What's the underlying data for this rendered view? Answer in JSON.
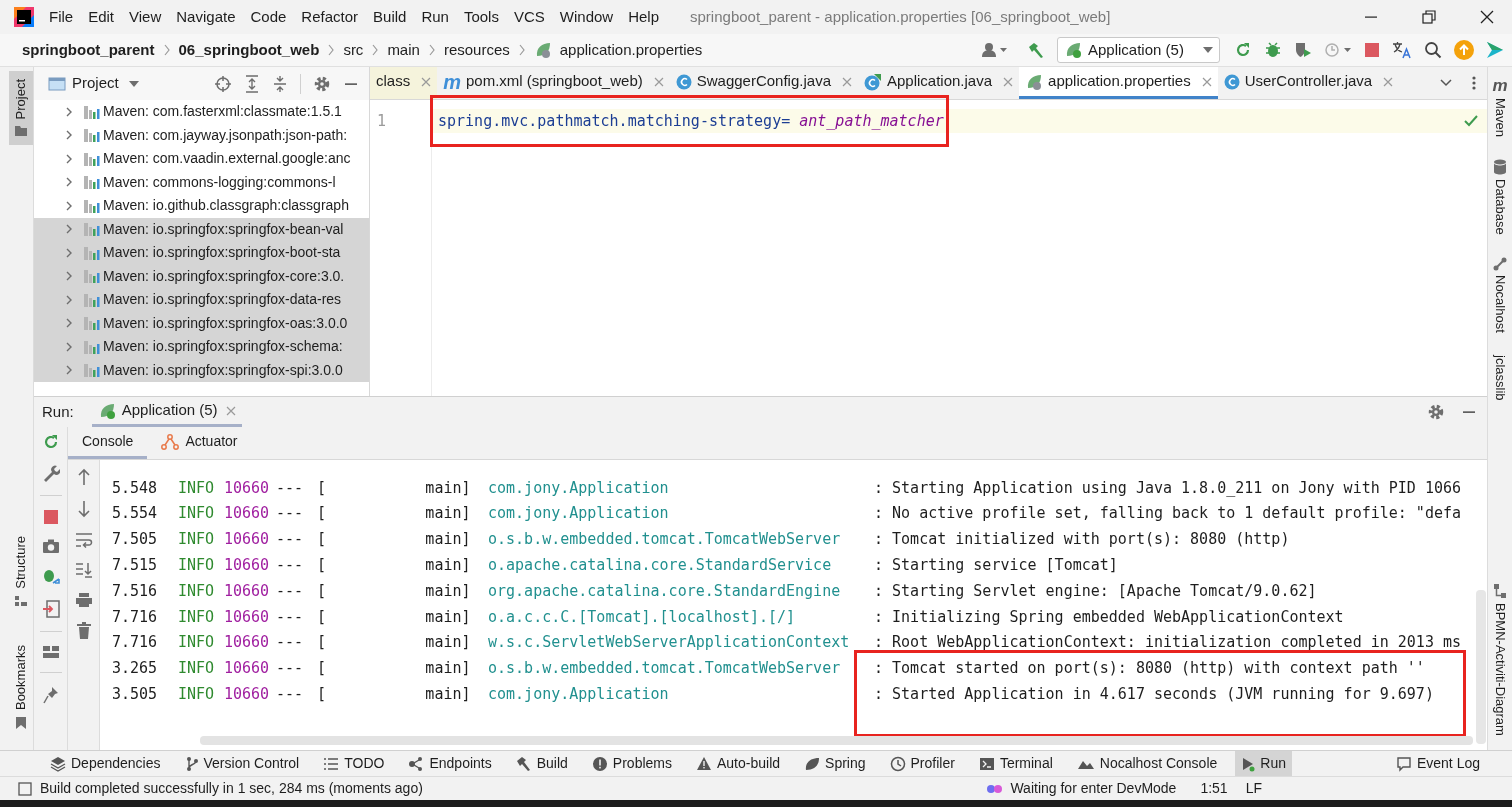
{
  "window": {
    "title": "springboot_parent - application.properties [06_springboot_web]"
  },
  "menu": [
    "File",
    "Edit",
    "View",
    "Navigate",
    "Code",
    "Refactor",
    "Build",
    "Run",
    "Tools",
    "VCS",
    "Window",
    "Help"
  ],
  "breadcrumb": [
    {
      "label": "springboot_parent",
      "bold": true
    },
    {
      "label": "06_springboot_web",
      "bold": true
    },
    {
      "label": "src",
      "bold": false
    },
    {
      "label": "main",
      "bold": false
    },
    {
      "label": "resources",
      "bold": false
    },
    {
      "label": "application.properties",
      "bold": false,
      "kind": "file"
    }
  ],
  "toolbar": {
    "run_config": "Application (5)"
  },
  "left_stripe": {
    "top": [
      {
        "label": "Project",
        "selected": true
      }
    ],
    "bottom": [
      {
        "label": "Structure",
        "selected": false
      },
      {
        "label": "Bookmarks",
        "selected": false
      }
    ]
  },
  "project_panel": {
    "title": "Project",
    "items": [
      {
        "label": "Maven: com.fasterxml:classmate:1.5.1",
        "selected": false,
        "expanded": false
      },
      {
        "label": "Maven: com.jayway.jsonpath:json-path:",
        "selected": false,
        "expanded": false
      },
      {
        "label": "Maven: com.vaadin.external.google:anc",
        "selected": false,
        "expanded": false
      },
      {
        "label": "Maven: commons-logging:commons-l",
        "selected": false,
        "expanded": false
      },
      {
        "label": "Maven: io.github.classgraph:classgraph",
        "selected": false,
        "expanded": false
      },
      {
        "label": "Maven: io.springfox:springfox-bean-val",
        "selected": true,
        "expanded": false
      },
      {
        "label": "Maven: io.springfox:springfox-boot-sta",
        "selected": true,
        "expanded": false
      },
      {
        "label": "Maven: io.springfox:springfox-core:3.0.",
        "selected": true,
        "expanded": false
      },
      {
        "label": "Maven: io.springfox:springfox-data-res",
        "selected": true,
        "expanded": false
      },
      {
        "label": "Maven: io.springfox:springfox-oas:3.0.0",
        "selected": true,
        "expanded": false
      },
      {
        "label": "Maven: io.springfox:springfox-schema:",
        "selected": true,
        "expanded": false
      },
      {
        "label": "Maven: io.springfox:springfox-spi:3.0.0",
        "selected": true,
        "expanded": false
      }
    ]
  },
  "editor_tabs": [
    {
      "label": "class",
      "kind": "class",
      "selected": false
    },
    {
      "label": "pom.xml (springboot_web)",
      "kind": "pom",
      "icon_text": "m",
      "selected": false
    },
    {
      "label": "SwaggerConfig.java",
      "kind": "java",
      "selected": false
    },
    {
      "label": "Application.java",
      "kind": "java-main",
      "selected": false
    },
    {
      "label": "application.properties",
      "kind": "properties",
      "selected": true
    },
    {
      "label": "UserController.java",
      "kind": "java",
      "selected": false
    }
  ],
  "editor": {
    "lines": [
      {
        "number": "1",
        "key": "spring.mvc.pathmatch.matching-strategy= ",
        "value": "ant_path_matcher",
        "highlighted": true
      }
    ]
  },
  "right_stripe": {
    "top": [
      {
        "label": "Maven",
        "icon_text": "m"
      },
      {
        "label": "Database"
      },
      {
        "label": "Nocalhost"
      },
      {
        "label": "jclasslib"
      }
    ],
    "bottom": [
      {
        "label": "BPMN-Activiti-Diagram"
      }
    ]
  },
  "run_panel": {
    "label": "Run:",
    "tab": "Application (5)",
    "console_tabs": [
      {
        "label": "Console",
        "selected": true
      },
      {
        "label": "Actuator",
        "selected": false
      }
    ],
    "rows": [
      {
        "time": "5.548",
        "level": "INFO",
        "pid": "10660",
        "sep": "---",
        "thread": "[           main]",
        "logger": "com.jony.Application",
        "message": ": Starting Application using Java 1.8.0_211 on Jony with PID 1066",
        "highlighted": false
      },
      {
        "time": "5.554",
        "level": "INFO",
        "pid": "10660",
        "sep": "---",
        "thread": "[           main]",
        "logger": "com.jony.Application",
        "message": ": No active profile set, falling back to 1 default profile: \"defa",
        "highlighted": false
      },
      {
        "time": "7.505",
        "level": "INFO",
        "pid": "10660",
        "sep": "---",
        "thread": "[           main]",
        "logger": "o.s.b.w.embedded.tomcat.TomcatWebServer",
        "message": ": Tomcat initialized with port(s): 8080 (http)",
        "highlighted": false
      },
      {
        "time": "7.515",
        "level": "INFO",
        "pid": "10660",
        "sep": "---",
        "thread": "[           main]",
        "logger": "o.apache.catalina.core.StandardService",
        "message": ": Starting service [Tomcat]",
        "highlighted": false
      },
      {
        "time": "7.516",
        "level": "INFO",
        "pid": "10660",
        "sep": "---",
        "thread": "[           main]",
        "logger": "org.apache.catalina.core.StandardEngine",
        "message": ": Starting Servlet engine: [Apache Tomcat/9.0.62]",
        "highlighted": false
      },
      {
        "time": "7.716",
        "level": "INFO",
        "pid": "10660",
        "sep": "---",
        "thread": "[           main]",
        "logger": "o.a.c.c.C.[Tomcat].[localhost].[/]",
        "message": ": Initializing Spring embedded WebApplicationContext",
        "highlighted": false
      },
      {
        "time": "7.716",
        "level": "INFO",
        "pid": "10660",
        "sep": "---",
        "thread": "[           main]",
        "logger": "w.s.c.ServletWebServerApplicationContext",
        "message": ": Root WebApplicationContext: initialization completed in 2013 ms",
        "highlighted": false
      },
      {
        "time": "3.265",
        "level": "INFO",
        "pid": "10660",
        "sep": "---",
        "thread": "[           main]",
        "logger": "o.s.b.w.embedded.tomcat.TomcatWebServer",
        "message": ": Tomcat started on port(s): 8080 (http) with context path ''",
        "highlighted": true
      },
      {
        "time": "3.505",
        "level": "INFO",
        "pid": "10660",
        "sep": "---",
        "thread": "[           main]",
        "logger": "com.jony.Application",
        "message": ": Started Application in 4.617 seconds (JVM running for 9.697)",
        "highlighted": true
      }
    ]
  },
  "bottom_tools": [
    {
      "label": "Dependencies",
      "selected": false
    },
    {
      "label": "Version Control",
      "selected": false
    },
    {
      "label": "TODO",
      "selected": false
    },
    {
      "label": "Endpoints",
      "selected": false
    },
    {
      "label": "Build",
      "selected": false
    },
    {
      "label": "Problems",
      "selected": false
    },
    {
      "label": "Auto-build",
      "selected": false
    },
    {
      "label": "Spring",
      "selected": false
    },
    {
      "label": "Profiler",
      "selected": false
    },
    {
      "label": "Terminal",
      "selected": false
    },
    {
      "label": "Nocalhost Console",
      "selected": false
    },
    {
      "label": "Run",
      "selected": true
    },
    {
      "label": "Event Log",
      "selected": false
    }
  ],
  "status_bar": {
    "message": "Build completed successfully in 1 sec, 284 ms (moments ago)",
    "devmode": "Waiting for enter DevMode",
    "position": "1:51",
    "line_separator": "LF"
  }
}
